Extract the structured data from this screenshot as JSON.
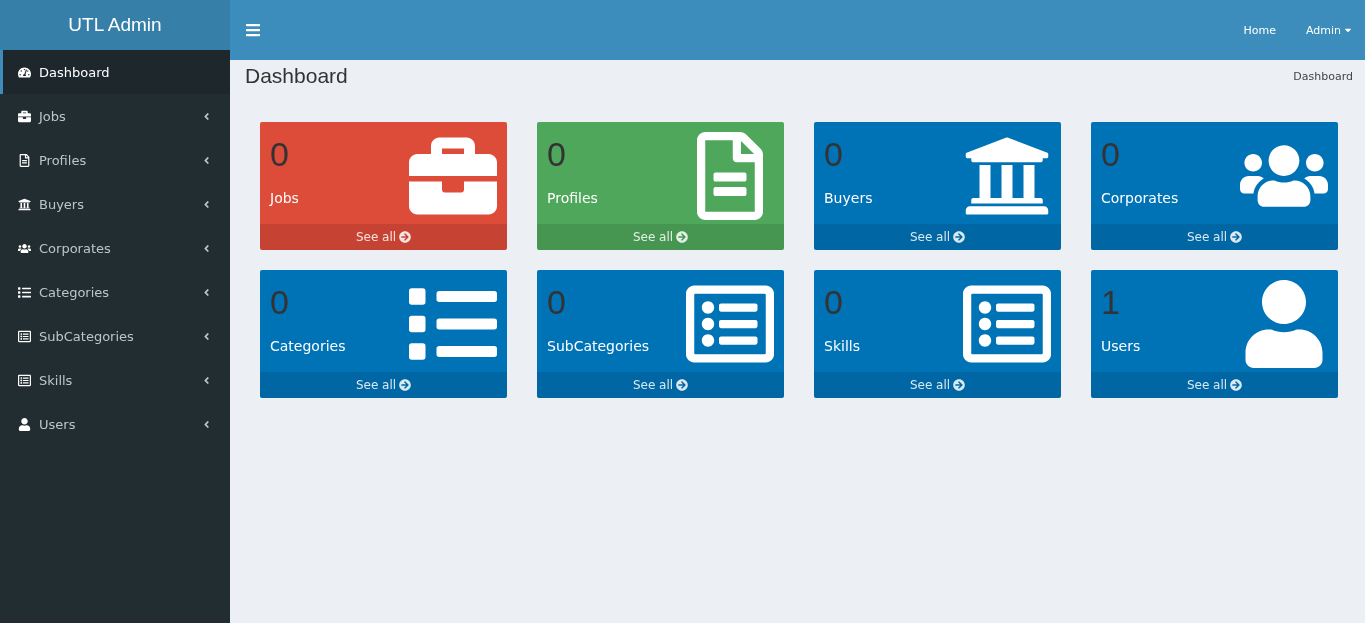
{
  "brand": "UTL Admin",
  "topbar": {
    "links": [
      {
        "label": "Home",
        "dropdown": false
      },
      {
        "label": "Admin",
        "dropdown": true
      }
    ]
  },
  "sidebar": {
    "items": [
      {
        "label": "Dashboard",
        "kind": "gauge",
        "selected": true,
        "expandable": false
      },
      {
        "label": "Jobs",
        "kind": "briefcase",
        "selected": false,
        "expandable": true
      },
      {
        "label": "Profiles",
        "kind": "document",
        "selected": false,
        "expandable": true
      },
      {
        "label": "Buyers",
        "kind": "bank",
        "selected": false,
        "expandable": true
      },
      {
        "label": "Corporates",
        "kind": "users",
        "selected": false,
        "expandable": true
      },
      {
        "label": "Categories",
        "kind": "list",
        "selected": false,
        "expandable": true
      },
      {
        "label": "SubCategories",
        "kind": "card",
        "selected": false,
        "expandable": true
      },
      {
        "label": "Skills",
        "kind": "card",
        "selected": false,
        "expandable": true
      },
      {
        "label": "Users",
        "kind": "user",
        "selected": false,
        "expandable": true
      }
    ]
  },
  "page": {
    "title": "Dashboard",
    "breadcrumb": "Dashboard"
  },
  "cards": [
    {
      "count": "0",
      "label": "Jobs",
      "link": "See all",
      "kind": "briefcase",
      "color": "#dd4b39"
    },
    {
      "count": "0",
      "label": "Profiles",
      "link": "See all",
      "kind": "document",
      "color": "#4ea75b"
    },
    {
      "count": "0",
      "label": "Buyers",
      "link": "See all",
      "kind": "bank",
      "color": "#0073b7"
    },
    {
      "count": "0",
      "label": "Corporates",
      "link": "See all",
      "kind": "users",
      "color": "#0073b7"
    },
    {
      "count": "0",
      "label": "Categories",
      "link": "See all",
      "kind": "list",
      "color": "#0073b7"
    },
    {
      "count": "0",
      "label": "SubCategories",
      "link": "See all",
      "kind": "card",
      "color": "#0073b7"
    },
    {
      "count": "0",
      "label": "Skills",
      "link": "See all",
      "kind": "card",
      "color": "#0073b7"
    },
    {
      "count": "1",
      "label": "Users",
      "link": "See all",
      "kind": "user",
      "color": "#0073b7"
    }
  ]
}
